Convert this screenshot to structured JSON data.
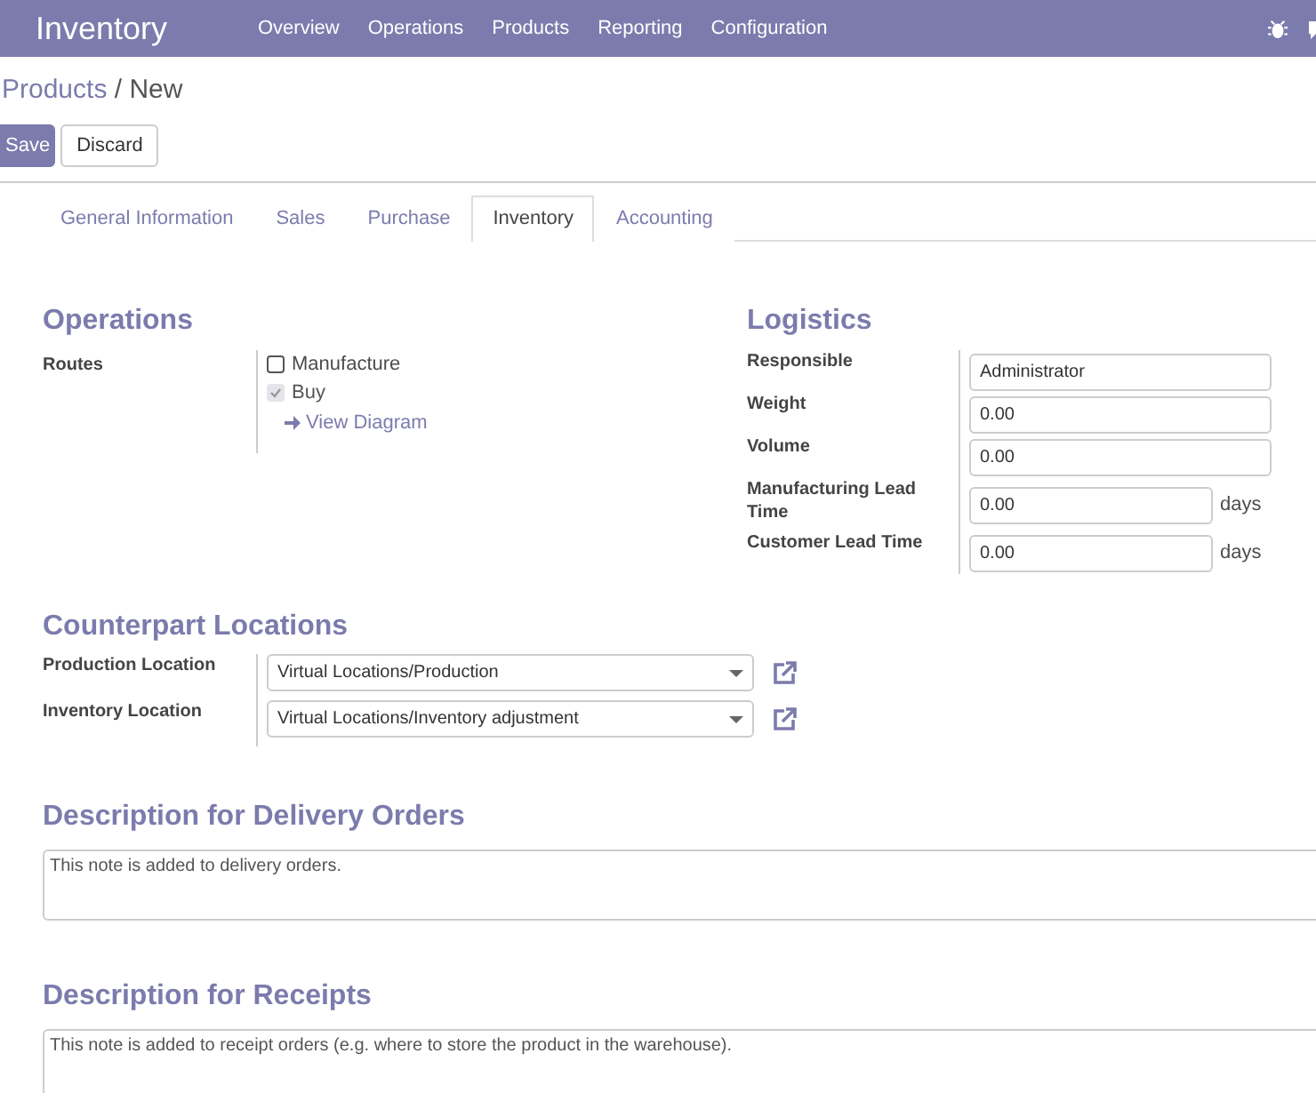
{
  "navbar": {
    "app_title": "Inventory",
    "menu": [
      "Overview",
      "Operations",
      "Products",
      "Reporting",
      "Configuration"
    ]
  },
  "breadcrumb": {
    "parent": "Products",
    "separator": "/",
    "current": "New"
  },
  "buttons": [
    {
      "label": "Save",
      "kind": "primary"
    },
    {
      "label": "Discard",
      "kind": "secondary"
    }
  ],
  "tabs": [
    {
      "label": "General Information",
      "selected": false
    },
    {
      "label": "Sales",
      "selected": false
    },
    {
      "label": "Purchase",
      "selected": false
    },
    {
      "label": "Inventory",
      "selected": true
    },
    {
      "label": "Accounting",
      "selected": false
    }
  ],
  "operations": {
    "title": "Operations",
    "label": "Routes",
    "options": [
      {
        "label": "Manufacture",
        "checked": false,
        "disabled": false
      },
      {
        "label": "Buy",
        "checked": true,
        "disabled": true
      }
    ],
    "link": "View Diagram"
  },
  "logistics": {
    "title": "Logistics",
    "fields": [
      {
        "label": "Responsible",
        "value": "Administrator"
      },
      {
        "label": "Weight",
        "value": "0.00"
      },
      {
        "label": "Volume",
        "value": "0.00"
      },
      {
        "label": "Manufacturing Lead Time",
        "value": "0.00",
        "unit": "days"
      },
      {
        "label": "Customer Lead Time",
        "value": "0.00",
        "unit": "days"
      }
    ]
  },
  "counterpart": {
    "title": "Counterpart Locations",
    "fields": [
      {
        "label": "Production Location",
        "value": "Virtual Locations/Production"
      },
      {
        "label": "Inventory Location",
        "value": "Virtual Locations/Inventory adjustment"
      }
    ]
  },
  "descriptions": [
    {
      "title": "Description for Delivery Orders",
      "placeholder": "This note is added to delivery orders."
    },
    {
      "title": "Description for Receipts",
      "placeholder": "This note is added to receipt orders (e.g. where to store the product in the warehouse)."
    }
  ]
}
